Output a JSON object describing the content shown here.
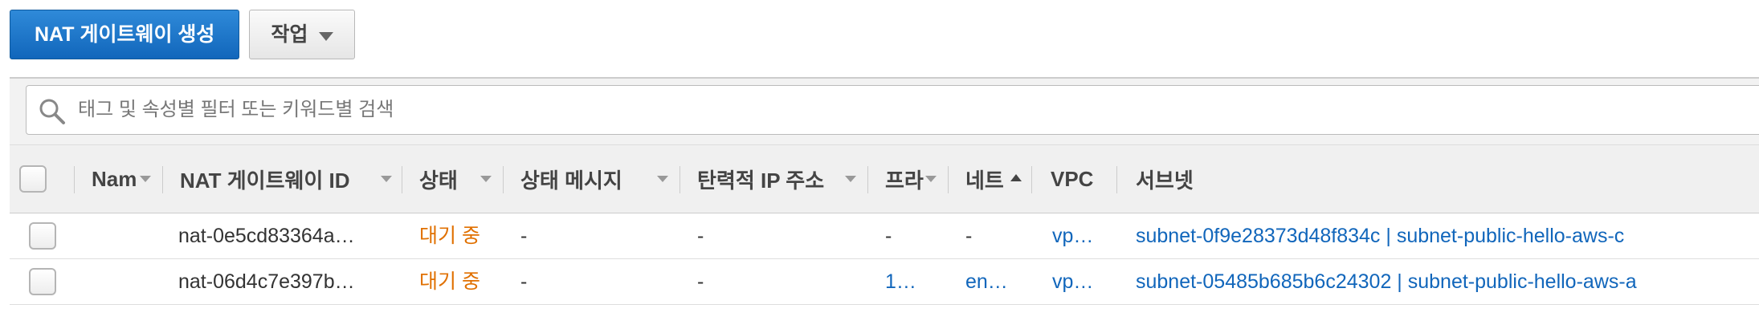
{
  "toolbar": {
    "create_label": "NAT 게이트웨이 생성",
    "actions_label": "작업"
  },
  "filter": {
    "placeholder": "태그 및 속성별 필터 또는 키워드별 검색"
  },
  "table": {
    "columns": [
      {
        "label": "Nam"
      },
      {
        "label": "NAT 게이트웨이 ID"
      },
      {
        "label": "상태"
      },
      {
        "label": "상태 메시지"
      },
      {
        "label": "탄력적 IP 주소"
      },
      {
        "label": "프라"
      },
      {
        "label": "네트"
      },
      {
        "label": "VPC"
      },
      {
        "label": "서브넷"
      }
    ],
    "rows": [
      {
        "nat_id": "nat-0e5cd83364a…",
        "state": "대기 중",
        "state_message": "-",
        "elastic_ip": "-",
        "private_ip": "-",
        "network": "-",
        "vpc": "vp…",
        "subnet": "subnet-0f9e28373d48f834c | subnet-public-hello-aws-c"
      },
      {
        "nat_id": "nat-06d4c7e397b…",
        "state": "대기 중",
        "state_message": "-",
        "elastic_ip": "-",
        "private_ip": "1…",
        "network": "en…",
        "vpc": "vp…",
        "subnet": "subnet-05485b685b6c24302 | subnet-public-hello-aws-a"
      }
    ]
  },
  "colors": {
    "primary_button": "#1a73c8",
    "link": "#1166bb",
    "state_pending": "#e07000"
  },
  "icons": {
    "search": "search-icon",
    "dropdown": "chevron-down-icon",
    "sort": "sort-caret-icon"
  }
}
